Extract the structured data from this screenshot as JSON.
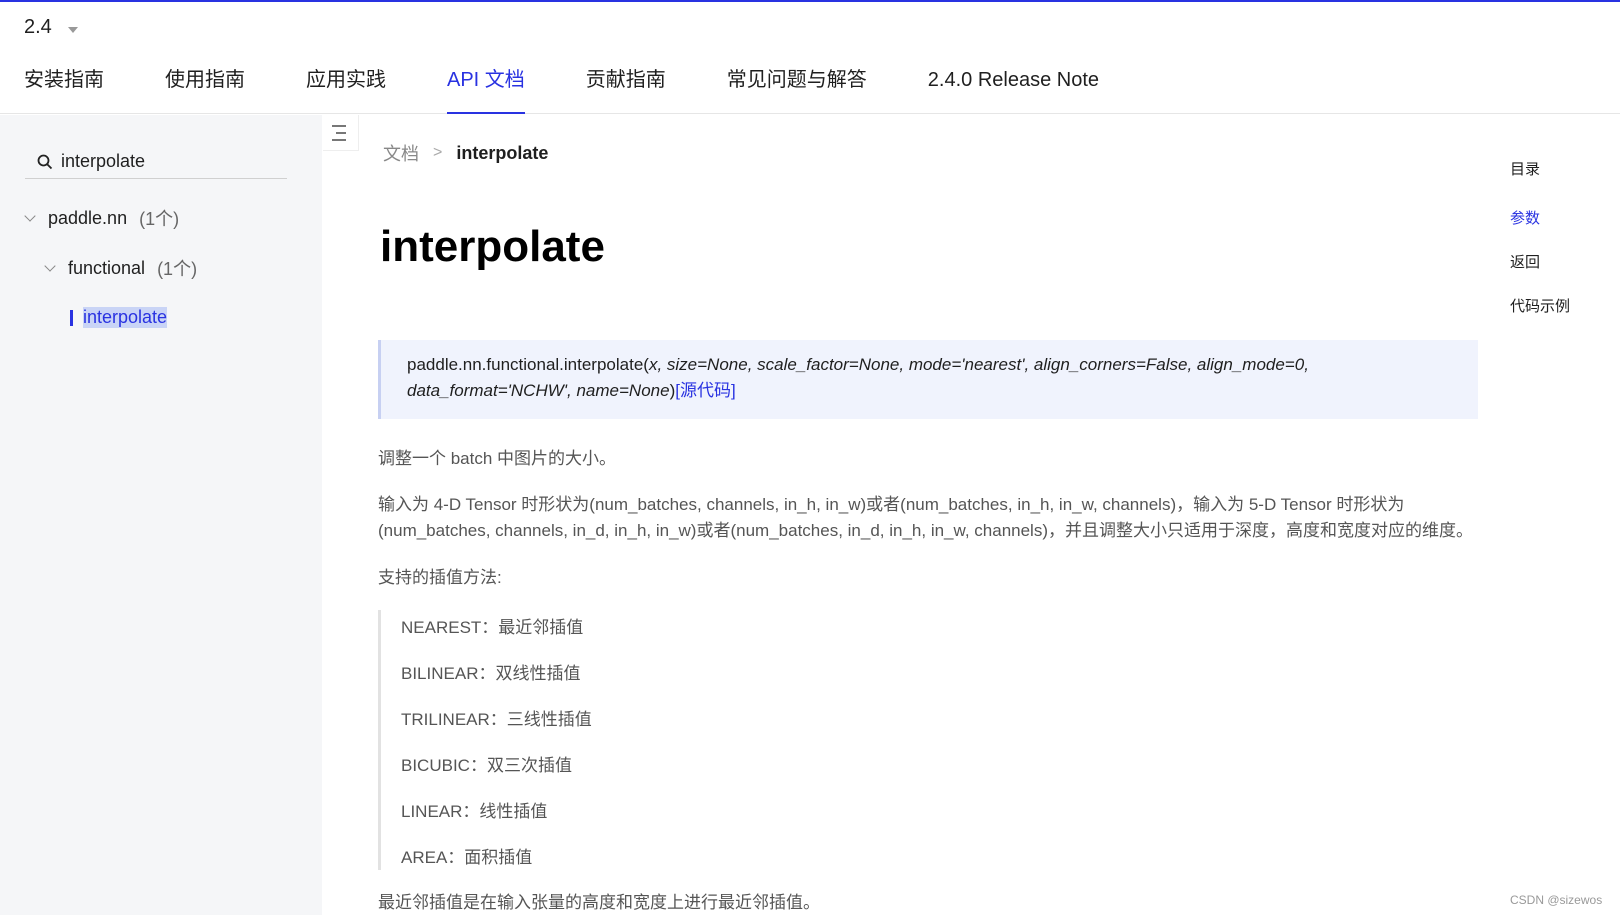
{
  "header": {
    "version": "2.4",
    "nav": [
      {
        "label": "安装指南",
        "active": false
      },
      {
        "label": "使用指南",
        "active": false
      },
      {
        "label": "应用实践",
        "active": false
      },
      {
        "label": "API 文档",
        "active": true
      },
      {
        "label": "贡献指南",
        "active": false
      },
      {
        "label": "常见问题与解答",
        "active": false
      },
      {
        "label": "2.4.0 Release Note",
        "active": false
      }
    ]
  },
  "sidebar": {
    "search_value": "interpolate",
    "tree": [
      {
        "label": "paddle.nn",
        "count": "(1个)"
      },
      {
        "label": "functional",
        "count": "(1个)"
      },
      {
        "label": "interpolate"
      }
    ]
  },
  "breadcrumb": {
    "root": "文档",
    "separator": ">",
    "current": "interpolate"
  },
  "main": {
    "title": "interpolate",
    "signature": {
      "name": "paddle.nn.functional.interpolate(",
      "args_line1": "x, size=None, scale_factor=None, mode='nearest', align_corners=False, align_mode=0,",
      "args_line2": "data_format='NCHW', name=None",
      "close": ")",
      "source_link": "[源代码]"
    },
    "intro": "调整一个 batch 中图片的大小。",
    "input_desc": "输入为 4-D Tensor 时形状为(num_batches, channels, in_h, in_w)或者(num_batches, in_h, in_w, channels)，输入为 5-D Tensor 时形状为(num_batches, channels, in_d, in_h, in_w)或者(num_batches, in_d, in_h, in_w, channels)，并且调整大小只适用于深度，高度和宽度对应的维度。",
    "methods_heading": "支持的插值方法:",
    "methods": [
      "NEAREST：最近邻插值",
      "BILINEAR：双线性插值",
      "TRILINEAR：三线性插值",
      "BICUBIC：双三次插值",
      "LINEAR：线性插值",
      "AREA：面积插值"
    ],
    "nearest_desc": "最近邻插值是在输入张量的高度和宽度上进行最近邻插值。"
  },
  "toc": {
    "heading": "目录",
    "items": [
      {
        "label": "参数",
        "active": true
      },
      {
        "label": "返回",
        "active": false
      },
      {
        "label": "代码示例",
        "active": false
      }
    ]
  },
  "watermark": "CSDN @sizewos",
  "colors": {
    "accent": "#2932e1",
    "sidebar_bg": "#f5f6f8",
    "signature_bg": "#f0f3fd"
  }
}
